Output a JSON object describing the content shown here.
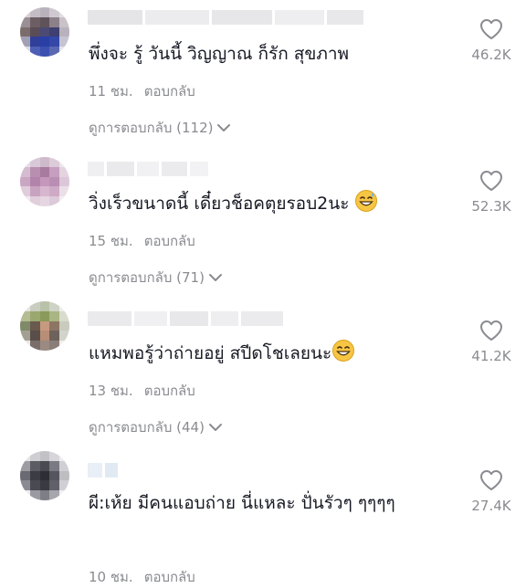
{
  "comments": [
    {
      "text": "พึ่งจะ รู้ วันนี้ วิญญาณ ก็รัก สุขภาพ",
      "time": "11 ชม.",
      "reply_label": "ตอบกลับ",
      "view_replies": "ดูการตอบกลับ (112)",
      "likes": "46.2K"
    },
    {
      "text": "วิ่งเร็วขนาดนี้ เดี๋ยวช็อคตุยรอบ2นะ",
      "emoji": "grinning-sweat-emoji",
      "time": "15 ชม.",
      "reply_label": "ตอบกลับ",
      "view_replies": "ดูการตอบกลับ (71)",
      "likes": "52.3K"
    },
    {
      "text": "แหมพอรู้ว่าถ่ายอยู่ สปีดโชเลยนะ",
      "emoji": "grinning-emoji",
      "time": "13 ชม.",
      "reply_label": "ตอบกลับ",
      "view_replies": "ดูการตอบกลับ (44)",
      "likes": "41.2K"
    },
    {
      "text": "ผี:เห้ย มีคนแอบถ่าย นี่แหละ ปั่นรัวๆ ๆๆๆๆ",
      "time": "10 ชม.",
      "reply_label": "ตอบกลับ",
      "likes": "27.4K"
    }
  ],
  "icons": {
    "like": "heart-outline-icon",
    "expand": "chevron-down-icon"
  },
  "colors": {
    "text": "#161823",
    "secondary": "#8a8b91",
    "background": "#ffffff"
  }
}
